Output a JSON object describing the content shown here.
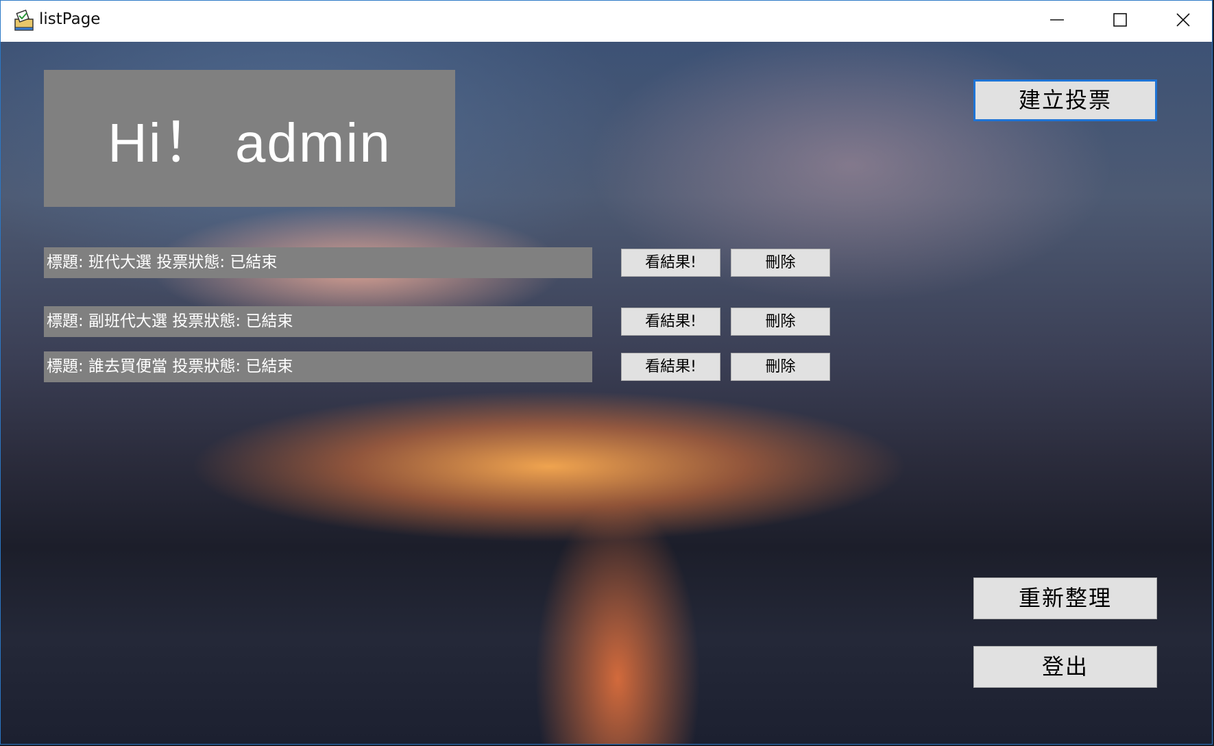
{
  "window": {
    "title": "listPage"
  },
  "greeting": "Hi！ admin",
  "buttons": {
    "create_vote": "建立投票",
    "refresh": "重新整理",
    "logout": "登出"
  },
  "votes": [
    {
      "label": "標題: 班代大選  投票狀態: 已結束",
      "result_label": "看結果!",
      "delete_label": "刪除"
    },
    {
      "label": "標題: 副班代大選  投票狀態: 已結束",
      "result_label": "看結果!",
      "delete_label": "刪除"
    },
    {
      "label": "標題: 誰去買便當  投票狀態: 已結束",
      "result_label": "看結果!",
      "delete_label": "刪除"
    }
  ],
  "colors": {
    "label_bg": "#808080",
    "button_bg": "#e1e1e1",
    "focus_border": "#1e74d6",
    "window_border": "#2b78c6"
  },
  "icons": {
    "app": "ballot-box-icon",
    "minimize": "minimize-icon",
    "maximize": "maximize-icon",
    "close": "close-icon"
  }
}
